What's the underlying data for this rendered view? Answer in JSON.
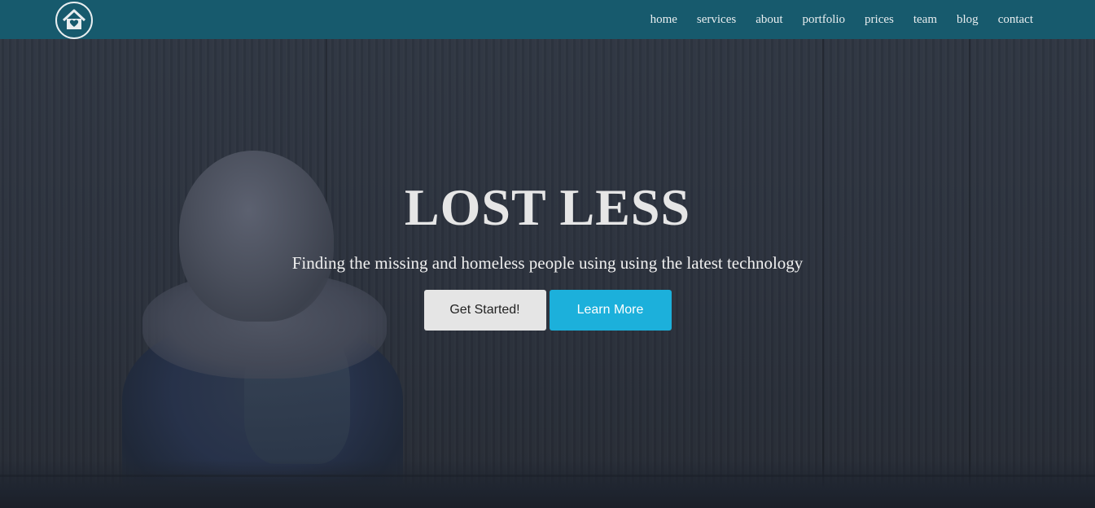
{
  "header": {
    "logo_icon": "house-heart-icon",
    "nav": [
      {
        "label": "home"
      },
      {
        "label": "services"
      },
      {
        "label": "about"
      },
      {
        "label": "portfolio"
      },
      {
        "label": "prices"
      },
      {
        "label": "team"
      },
      {
        "label": "blog"
      },
      {
        "label": "contact"
      }
    ]
  },
  "hero": {
    "title": "LOST LESS",
    "tagline": "Finding the missing and homeless people using using the latest technology",
    "primary_button": "Get Started!",
    "secondary_button": "Learn More"
  },
  "colors": {
    "navbar": "#175a6d",
    "accent": "#1cb0db",
    "light_button": "#e5e5e5"
  }
}
